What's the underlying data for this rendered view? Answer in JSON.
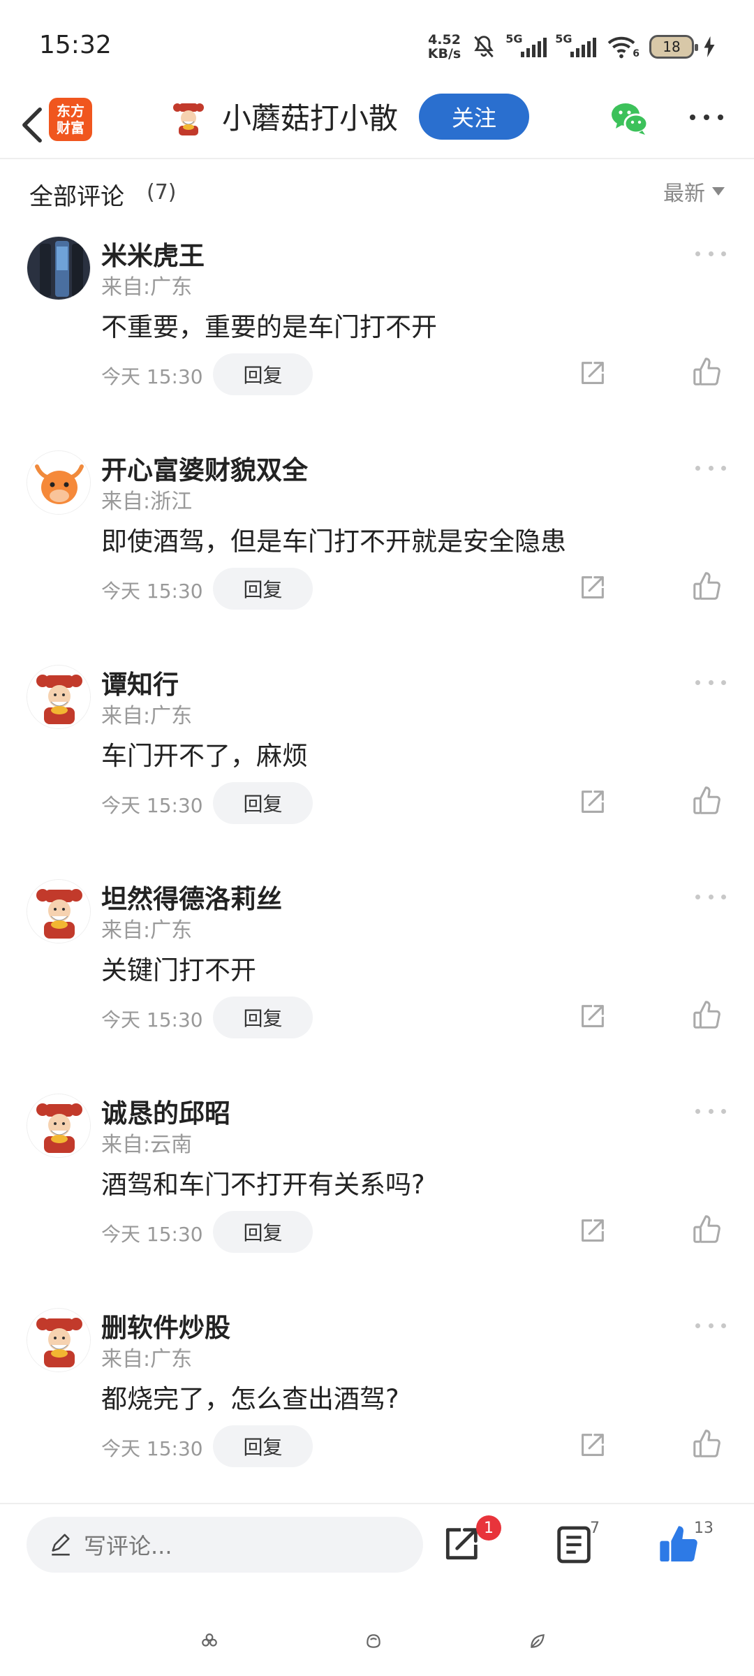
{
  "status_bar": {
    "time": "15:32",
    "net_speed_value": "4.52",
    "net_speed_unit": "KB/s",
    "sim1_label": "5G",
    "sim2_label": "5G",
    "wifi_label": "6",
    "battery_level": "18"
  },
  "header": {
    "app_logo_line1": "东方",
    "app_logo_line2": "财富",
    "author_name": "小蘑菇打小散",
    "follow_label": "关注"
  },
  "comments_header": {
    "title": "全部评论",
    "count": "(7)",
    "sort_label": "最新"
  },
  "comments": [
    {
      "name": "米米虎王",
      "location": "来自:广东",
      "text": "不重要，重要的是车门打不开",
      "time": "今天 15:30",
      "reply_label": "回复",
      "avatar": "photo-avatar"
    },
    {
      "name": "开心富婆财貌双全",
      "location": "来自:浙江",
      "text": "即使酒驾，但是车门打不开就是安全隐患",
      "time": "今天 15:30",
      "reply_label": "回复",
      "avatar": "ox-avatar"
    },
    {
      "name": "谭知行",
      "location": "来自:广东",
      "text": "车门开不了，麻烦",
      "time": "今天 15:30",
      "reply_label": "回复",
      "avatar": "fortune-god-avatar"
    },
    {
      "name": "坦然得德洛莉丝",
      "location": "来自:广东",
      "text": "关键门打不开",
      "time": "今天 15:30",
      "reply_label": "回复",
      "avatar": "fortune-god-avatar"
    },
    {
      "name": "诚恳的邱昭",
      "location": "来自:云南",
      "text": "酒驾和车门不打开有关系吗?",
      "time": "今天 15:30",
      "reply_label": "回复",
      "avatar": "fortune-god-avatar"
    },
    {
      "name": "删软件炒股",
      "location": "来自:广东",
      "text": "都烧完了，怎么查出酒驾?",
      "time": "今天 15:30",
      "reply_label": "回复",
      "avatar": "fortune-god-avatar"
    }
  ],
  "bottom_bar": {
    "input_placeholder": "写评论...",
    "share_badge": "1",
    "comments_count": "7",
    "likes_count": "13"
  },
  "colors": {
    "accent_blue": "#2a6fcf",
    "brand_orange": "#f0561e",
    "badge_red": "#e8343b",
    "like_blue": "#2d7ae6",
    "wechat_green": "#3cc15a"
  }
}
